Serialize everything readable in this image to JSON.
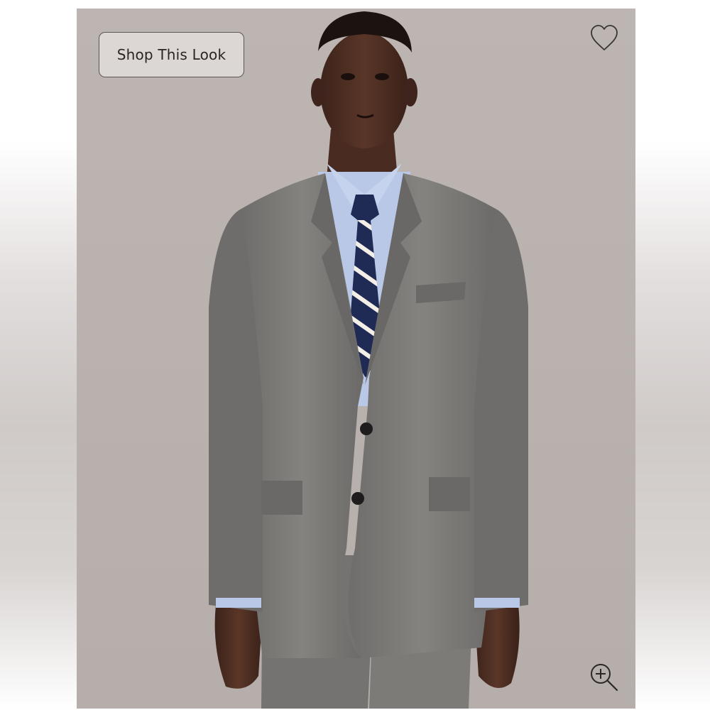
{
  "product_image": {
    "shop_button_label": "Shop This Look",
    "wishlist_icon": "heart-outline-icon",
    "zoom_icon": "zoom-in-icon"
  },
  "colors": {
    "backdrop": "#bcb5b1",
    "suit": "#7b7977",
    "shirt": "#b9c8e6",
    "tie_navy": "#1f2a55",
    "tie_stripe": "#f3efe6",
    "skin": "#4a2c22"
  }
}
